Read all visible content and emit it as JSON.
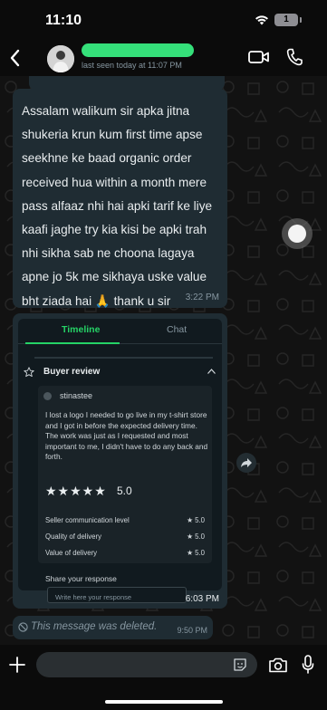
{
  "status_bar": {
    "time": "11:10",
    "battery": "1"
  },
  "header": {
    "contact_name": "",
    "last_seen": "last seen today at 11:07 PM"
  },
  "messages": [
    {
      "text": "Assalam walikum sir apka jitna shukeria krun kum first time apse seekhne ke baad organic order received hua within a month mere pass alfaaz nhi hai apki tarif ke liye kaafi jaghe try kia kisi be apki trah nhi sikha sab ne choona lagaya apne jo 5k me sikhaya uske value bht ziada hai 🙏 thank u sir",
      "time": "3:22 PM"
    }
  ],
  "review_card": {
    "tabs": [
      "Timeline",
      "Chat"
    ],
    "active_tab": "Timeline",
    "section_title": "Buyer review",
    "reviewer": "stinastee",
    "review_text": "I lost a logo I needed to go live in my t-shirt store and I got in before the expected delivery time.  The work was just as I requested and most important to me, I didn't have to do any back and forth.",
    "stars": "★★★★★",
    "rating": "5.0",
    "rating_rows": [
      {
        "label": "Seller communication level",
        "value": "★ 5.0"
      },
      {
        "label": "Quality of delivery",
        "value": "★ 5.0"
      },
      {
        "label": "Value of delivery",
        "value": "★ 5.0"
      }
    ],
    "share_label": "Share your response",
    "response_placeholder": "Write here your response",
    "time": "6:03 PM"
  },
  "deleted_message": {
    "text": "This message was deleted.",
    "time": "9:50 PM"
  },
  "input_bar": {
    "placeholder": ""
  },
  "colors": {
    "accent": "#25d366",
    "bubble": "#1f2c33",
    "background": "#121212",
    "name_highlight": "#35e07a"
  },
  "icons": [
    "back-icon",
    "video-icon",
    "phone-icon",
    "wifi-icon",
    "star-outline-icon",
    "chevron-up-icon",
    "forward-icon",
    "blocked-icon",
    "plus-icon",
    "sticker-icon",
    "camera-icon",
    "mic-icon"
  ]
}
